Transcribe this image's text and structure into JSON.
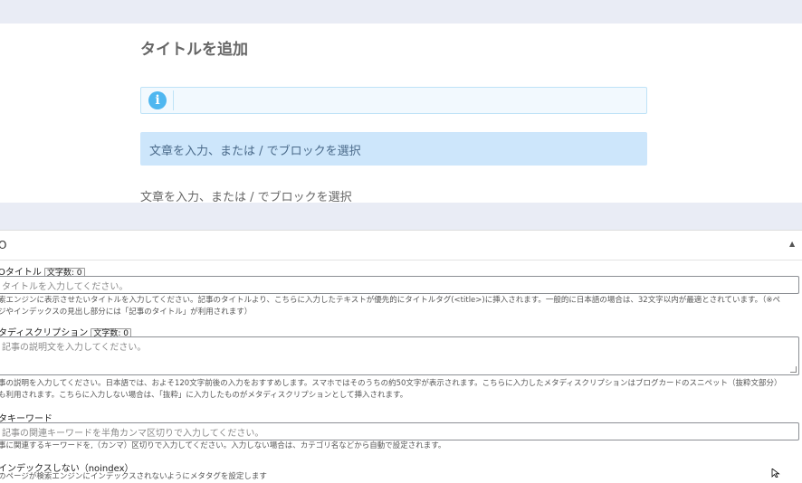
{
  "editor": {
    "title_placeholder": "タイトルを追加",
    "info_icon_glyph": "i",
    "block_placeholder_selected": "文章を入力、または / でブロックを選択",
    "block_placeholder": "文章を入力、または / でブロックを選択"
  },
  "seo": {
    "header": "O",
    "seo_title": {
      "label": "Oタイトル",
      "count_label": "文字数: 0",
      "placeholder": "タイトルを入力してください。",
      "help_line1": "索エンジンに表示させたいタイトルを入力してください。記事のタイトルより、こちらに入力したテキストが優先的にタイトルタグ(<title>)に挿入されます。一般的に日本語の場合は、32文字以内が最適とされています。（※ペ",
      "help_line2": "ジやインデックスの見出し部分には「記事のタイトル」が利用されます）"
    },
    "meta_description": {
      "label": "タディスクリプション",
      "count_label": "文字数: 0",
      "placeholder": "記事の説明文を入力してください。",
      "help_line1": "事の説明を入力してください。日本語では、およそ120文字前後の入力をおすすめします。スマホではそのうちの約50文字が表示されます。こちらに入力したメタディスクリプションはブログカードのスニペット（抜粋文部分）",
      "help_line2": "も利用されます。こちらに入力しない場合は、「抜粋」に入力したものがメタディスクリプションとして挿入されます。"
    },
    "meta_keywords": {
      "label": "タキーワード",
      "placeholder": "記事の関連キーワードを半角カンマ区切りで入力してください。",
      "help": "事に関連するキーワードを,（カンマ）区切りで入力してください。入力しない場合は、カテゴリ名などから自動で設定されます。"
    },
    "noindex": {
      "label": "インデックスしない（noindex）",
      "help": "のページが検索エンジンにインデックスされないようにメタタグを設定します"
    }
  }
}
